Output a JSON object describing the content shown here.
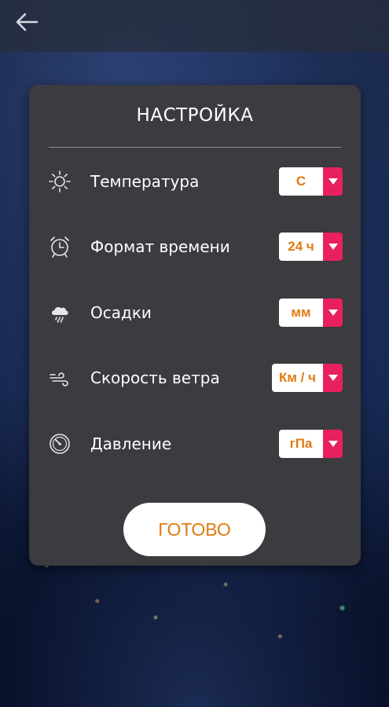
{
  "dialog": {
    "title": "НАСТРОЙКА",
    "done_label": "ГОТОВО"
  },
  "settings": [
    {
      "label": "Температура",
      "value": "C",
      "icon": "sun-icon"
    },
    {
      "label": "Формат времени",
      "value": "24 ч",
      "icon": "alarm-clock-icon"
    },
    {
      "label": "Осадки",
      "value": "мм",
      "icon": "rain-cloud-icon"
    },
    {
      "label": "Скорость ветра",
      "value": "Км / ч",
      "icon": "wind-icon"
    },
    {
      "label": "Давление",
      "value": "гПа",
      "icon": "gauge-icon"
    }
  ],
  "colors": {
    "accent": "#e8205e",
    "value_text": "#e07a12",
    "panel": "#3b3b40"
  }
}
